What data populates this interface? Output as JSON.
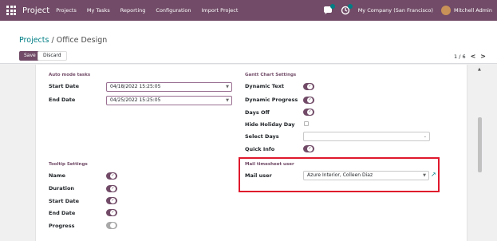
{
  "topbar": {
    "app_title": "Project",
    "menu": [
      "Projects",
      "My Tasks",
      "Reporting",
      "Configuration",
      "Import Project"
    ],
    "company": "My Company (San Francisco)",
    "user": "Mitchell Admin",
    "icons": [
      "apps-icon",
      "chat-icon",
      "activity-icon"
    ]
  },
  "breadcrumb": {
    "parent": "Projects",
    "separator": "/",
    "current": "Office Design"
  },
  "buttons": {
    "save": "Save",
    "discard": "Discard"
  },
  "pager": {
    "value": "1 / 6",
    "prev": "<",
    "next": ">"
  },
  "auto_mode": {
    "title": "Auto mode tasks",
    "start_label": "Start Date",
    "start_value": "04/18/2022 15:25:05",
    "end_label": "End Date",
    "end_value": "04/25/2022 15:25:05"
  },
  "gantt": {
    "title": "Gantt Chart Settings",
    "dynamic_text": "Dynamic Text",
    "dynamic_progress": "Dynamic Progress",
    "days_off": "Days Off",
    "hide_holiday": "Hide Holiday Day",
    "select_days": "Select Days",
    "quick_info": "Quick Info",
    "dynamic_text_on": true,
    "dynamic_progress_on": true,
    "days_off_on": true,
    "hide_holiday_on": false,
    "quick_info_on": true
  },
  "tooltip": {
    "title": "Tooltip Settings",
    "name": "Name",
    "duration": "Duration",
    "start_date": "Start Date",
    "end_date": "End Date",
    "progress": "Progress",
    "name_on": true,
    "duration_on": true,
    "start_date_on": true,
    "end_date_on": true,
    "progress_on": false
  },
  "mail": {
    "title": "Mail timesheet user",
    "label": "Mail user",
    "value": "Azure Interior, Colleen Diaz"
  },
  "colors": {
    "brand": "#714b67",
    "link": "#017e84",
    "highlight": "#e0182d"
  }
}
